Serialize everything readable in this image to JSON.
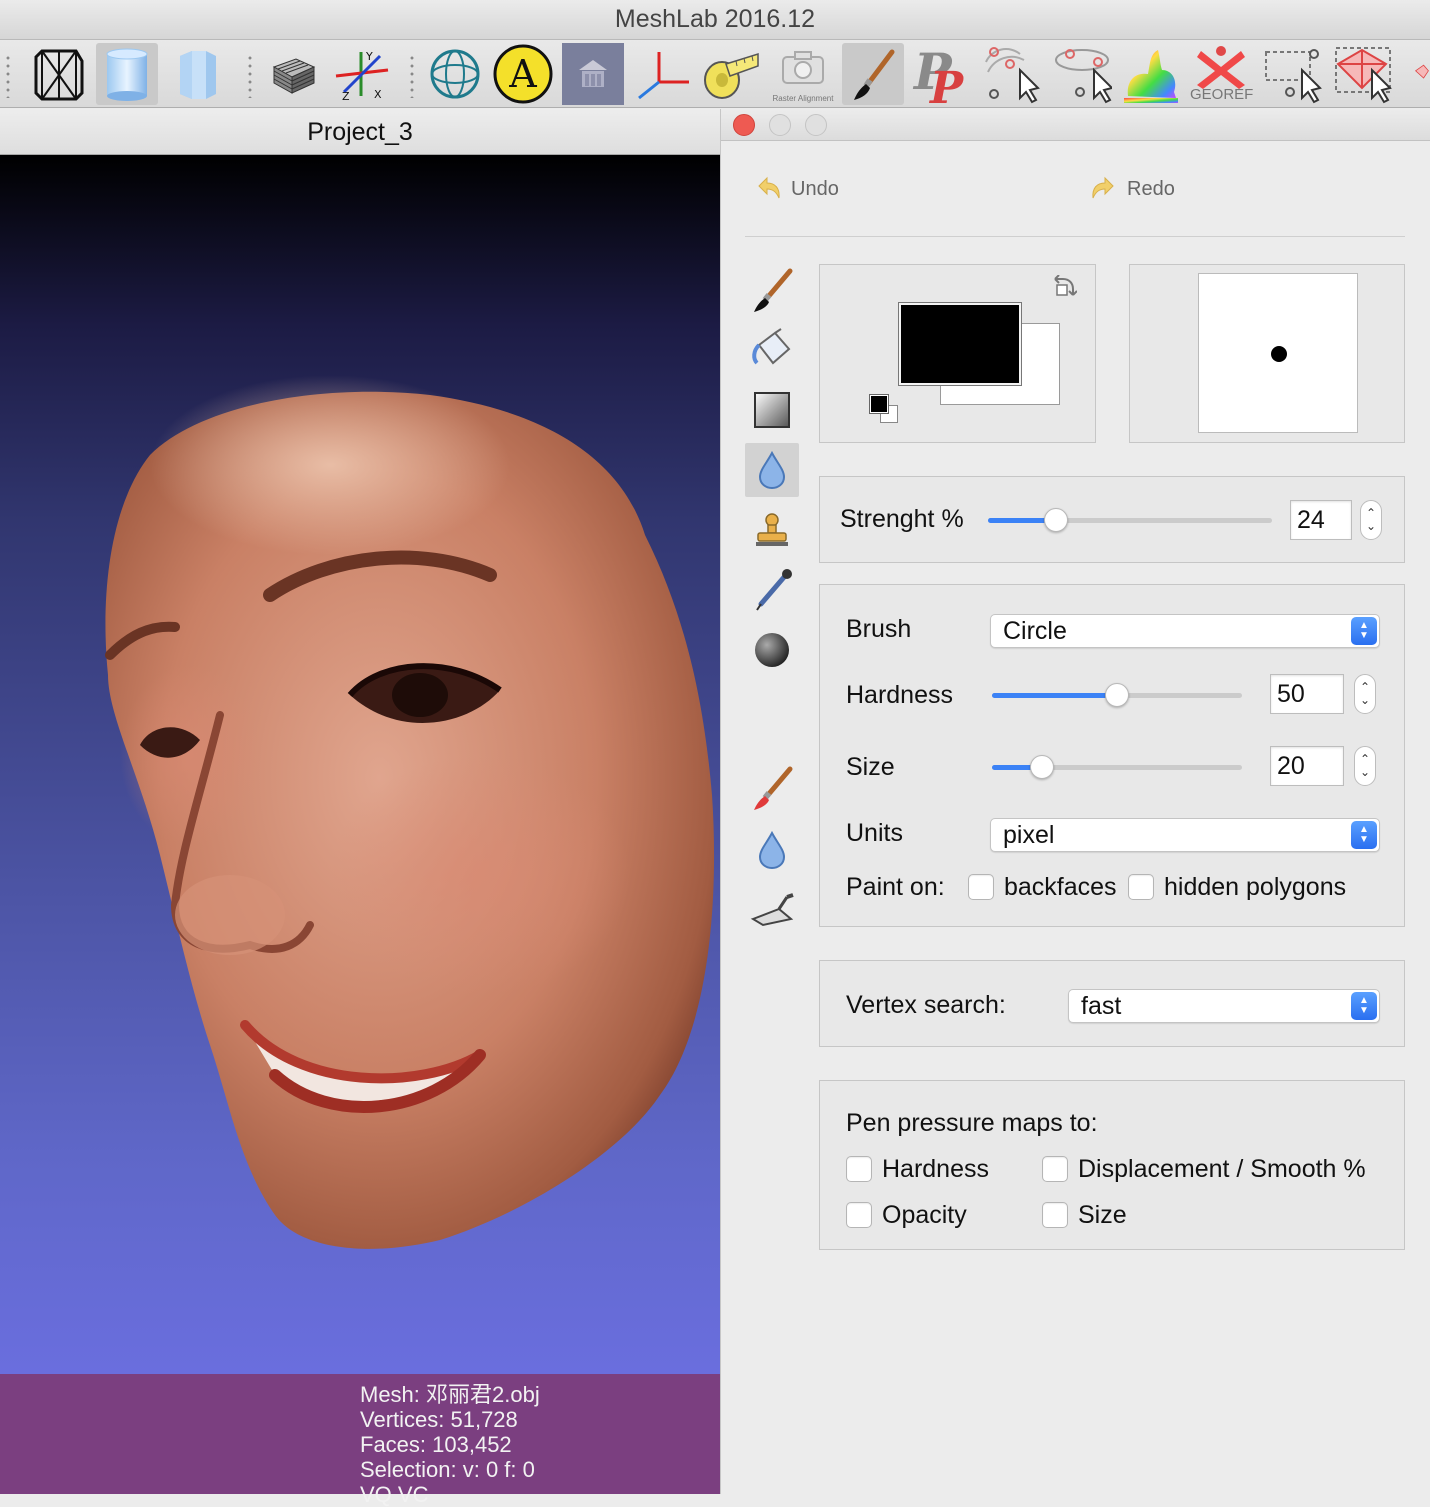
{
  "window": {
    "title": "MeshLab 2016.12"
  },
  "toolbar": {
    "raster_caption": "Raster Alignment",
    "georef_label": "GEOREF"
  },
  "project": {
    "tab_title": "Project_3"
  },
  "info": {
    "mesh": "Mesh: 邓丽君2.obj",
    "vertices": "Vertices: 51,728",
    "faces": "Faces: 103,452",
    "selection": "Selection: v: 0 f: 0",
    "vq": "VQ VC"
  },
  "dialog": {
    "undo_label": "Undo",
    "redo_label": "Redo",
    "colors": {
      "foreground": "#000000",
      "background": "#ffffff"
    },
    "strength": {
      "label": "Strenght %",
      "value": "24",
      "percent": 24
    },
    "brush": {
      "label": "Brush",
      "selected": "Circle"
    },
    "hardness": {
      "label": "Hardness",
      "value": "50",
      "percent": 50
    },
    "size": {
      "label": "Size",
      "value": "20",
      "percent": 20
    },
    "units": {
      "label": "Units",
      "selected": "pixel"
    },
    "paint_on": {
      "label": "Paint on:",
      "backfaces": "backfaces",
      "hidden": "hidden polygons"
    },
    "vertex_search": {
      "label": "Vertex search:",
      "selected": "fast"
    },
    "pen_pressure": {
      "title": "Pen pressure maps to:",
      "hardness": "Hardness",
      "displacement": "Displacement / Smooth %",
      "opacity": "Opacity",
      "size": "Size"
    }
  },
  "accent_color": "#3b82f6",
  "viewport_colors": {
    "top": "#000000",
    "bottom": "#6a6ede",
    "infobar": "#7b3f80"
  }
}
